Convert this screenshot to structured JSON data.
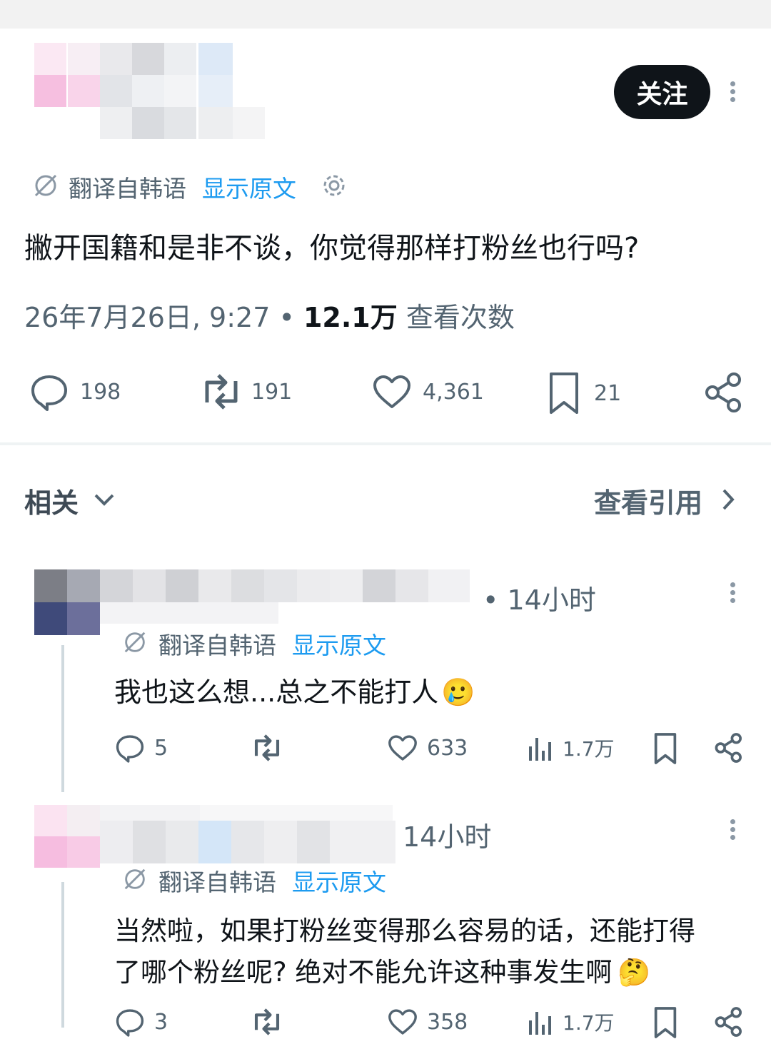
{
  "main_post": {
    "follow_label": "关注",
    "translated_from": "翻译自韩语",
    "show_original": "显示原文",
    "text": "撇开国籍和是非不谈，你觉得那样打粉丝也行吗?",
    "timestamp": "26年7月26日, 9:27 •",
    "views_count": "12.1万",
    "views_label": "查看次数",
    "replies": "198",
    "reposts": "191",
    "likes": "4,361",
    "bookmarks": "21"
  },
  "section": {
    "related_label": "相关",
    "view_quotes": "查看引用"
  },
  "replies": [
    {
      "time": "• 14小时",
      "translated_from": "翻译自韩语",
      "show_original": "显示原文",
      "text": "我也这么想...总之不能打人",
      "emoji": "🥲",
      "replies": "5",
      "reposts": "",
      "likes": "633",
      "views": "1.7万"
    },
    {
      "time": "14小时",
      "translated_from": "翻译自韩语",
      "show_original": "显示原文",
      "text_line1": "当然啦，如果打粉丝变得那么容易的话，还能打得",
      "text_line2": "了哪个粉丝呢? 绝对不能允许这种事发生啊",
      "emoji": "🤔",
      "replies": "3",
      "likes": "358",
      "views": "1.7万"
    }
  ],
  "colors": {
    "text": "#0f1419",
    "secondary": "#536471",
    "link": "#1d9bf0",
    "follow_bg": "#0f1419"
  }
}
